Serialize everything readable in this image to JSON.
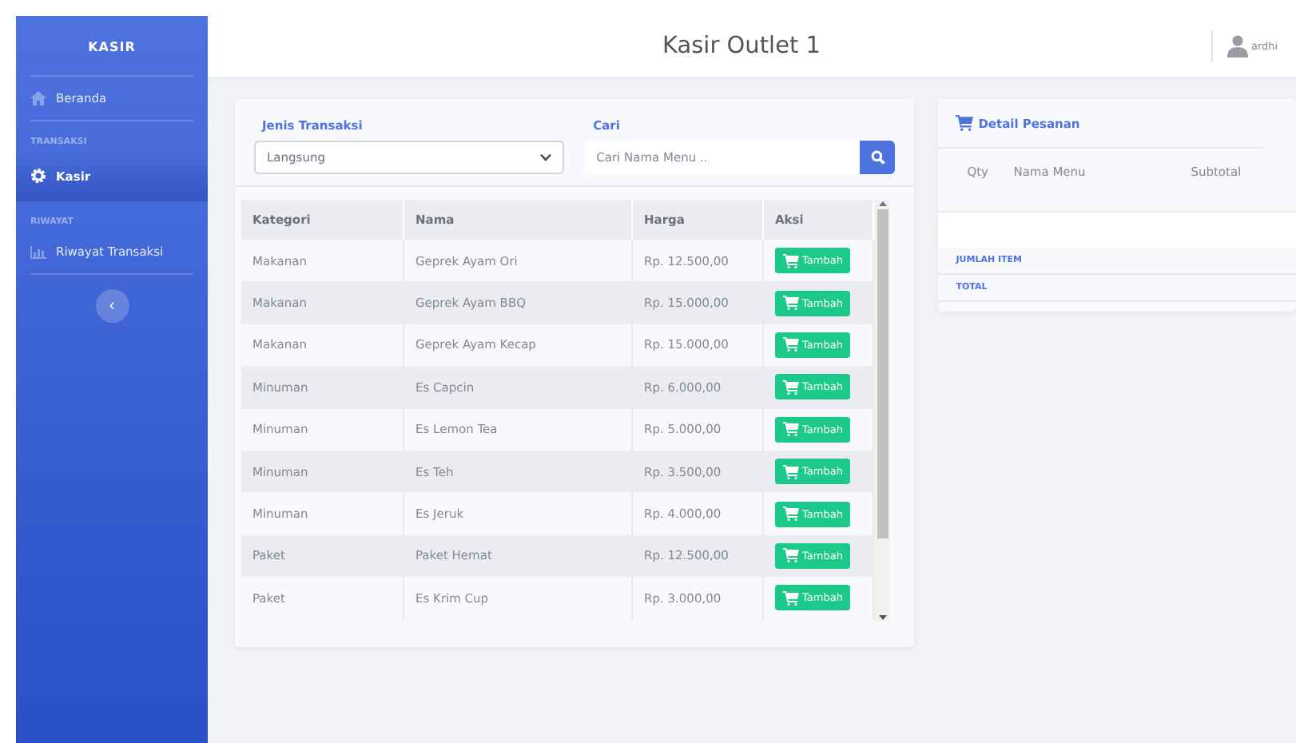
{
  "sidebar": {
    "brand": "KASIR",
    "sections": [
      {
        "items": [
          {
            "label": "Beranda",
            "selected": false
          }
        ]
      },
      {
        "heading": "TRANSAKSI",
        "items": [
          {
            "label": "Kasir",
            "selected": true
          }
        ]
      },
      {
        "heading": "RIWAYAT",
        "items": [
          {
            "label": "Riwayat Transaksi",
            "selected": false
          }
        ]
      }
    ],
    "toggle": "‹"
  },
  "topbar": {
    "title": "Kasir Outlet 1",
    "user": "ardhi"
  },
  "order_form": {
    "type_label": "Jenis Transaksi",
    "type_value": "Langsung",
    "search_label": "Cari",
    "search_placeholder": "Cari Nama Menu .."
  },
  "menu_table": {
    "columns": [
      "Kategori",
      "Nama",
      "Harga",
      "Aksi"
    ],
    "rows": [
      {
        "category": "Makanan",
        "name": "Geprek Ayam Ori",
        "price": "Rp. 12.500,00",
        "action": "Tambah"
      },
      {
        "category": "Makanan",
        "name": "Geprek Ayam BBQ",
        "price": "Rp. 15.000,00",
        "action": "Tambah"
      },
      {
        "category": "Makanan",
        "name": "Geprek Ayam Kecap",
        "price": "Rp. 15.000,00",
        "action": "Tambah"
      },
      {
        "category": "Minuman",
        "name": "Es Capcin",
        "price": "Rp. 6.000,00",
        "action": "Tambah"
      },
      {
        "category": "Minuman",
        "name": "Es Lemon Tea",
        "price": "Rp. 5.000,00",
        "action": "Tambah"
      },
      {
        "category": "Minuman",
        "name": "Es Teh",
        "price": "Rp. 3.500,00",
        "action": "Tambah"
      },
      {
        "category": "Minuman",
        "name": "Es Jeruk",
        "price": "Rp. 4.000,00",
        "action": "Tambah"
      },
      {
        "category": "Paket",
        "name": "Paket Hemat",
        "price": "Rp. 12.500,00",
        "action": "Tambah"
      },
      {
        "category": "Paket",
        "name": "Es Krim Cup",
        "price": "Rp. 3.000,00",
        "action": "Tambah"
      }
    ]
  },
  "order_detail": {
    "title": "Detail Pesanan",
    "columns": [
      "Qty",
      "Nama Menu",
      "Subtotal"
    ],
    "summary": [
      "JUMLAH ITEM",
      "TOTAL"
    ]
  }
}
